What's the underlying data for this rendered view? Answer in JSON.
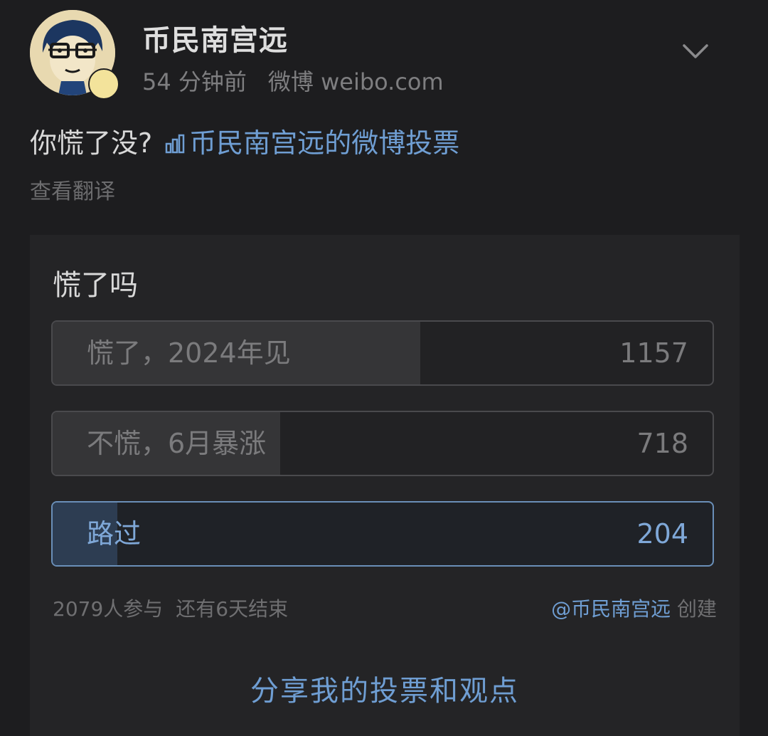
{
  "post": {
    "username": "币民南宫远",
    "time": "54 分钟前",
    "source": "微博 weibo.com",
    "text": "你慌了没?",
    "vote_link": "币民南宫远的微博投票",
    "translate": "查看翻译"
  },
  "poll": {
    "question": "慌了吗",
    "options": [
      {
        "label": "慌了，2024年见",
        "count": "1157",
        "share": 0.557
      },
      {
        "label": "不慌，6月暴涨",
        "count": "718",
        "share": 0.345
      },
      {
        "label": "路过",
        "count": "204",
        "share": 0.098,
        "selected": true
      }
    ],
    "participants": "2079人参与",
    "remaining": "还有6天结束",
    "creator": "@币民南宫远",
    "created": "创建",
    "share_label": "分享我的投票和观点"
  },
  "colors": {
    "background": "#1d1d1f",
    "link": "#6f9ed3",
    "selected_border": "#6a8fb8"
  },
  "icons": {
    "chevron": "chevron-down-icon",
    "vote": "bar-chart-icon"
  }
}
